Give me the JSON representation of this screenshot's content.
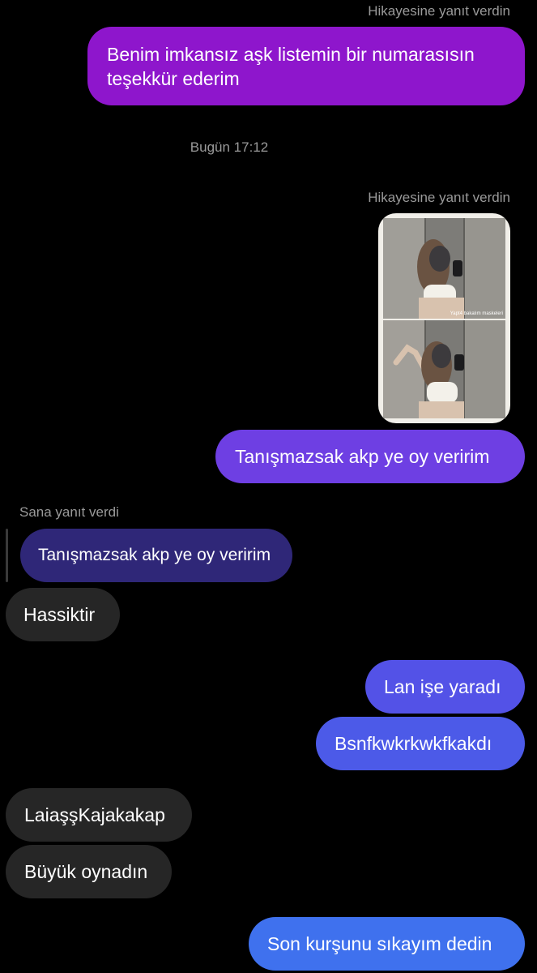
{
  "conversation": {
    "story_reply_label_1": "Hikayesine yanıt verdin",
    "msg_1": "Benim imkansız aşk listemin bir numarasısın teşekkür ederim",
    "timestamp": "Bugün 17:12",
    "story_reply_label_2": "Hikayesine yanıt verdin",
    "story_caption": "Yapt4 bakalım maskeleri",
    "msg_2": "Tanışmazsak akp ye oy veririm",
    "reply_label": "Sana yanıt verdi",
    "quoted_msg": "Tanışmazsak akp ye oy veririm",
    "msg_3": "Hassiktir",
    "msg_4": "Lan işe yaradı",
    "msg_5": "Bsnfkwkrkwkfkakdı",
    "msg_6": "LaiaşşKajakakap",
    "msg_7": "Büyük oynadın",
    "msg_8": "Son kurşunu sıkayım dedin"
  },
  "colors": {
    "background": "#000000",
    "outgoing_purple": "#8e16cc",
    "outgoing_violet": "#6e3fe3",
    "outgoing_blue": "#3f71ee",
    "incoming_gray": "#262626",
    "quoted_reply": "#2f2778",
    "meta_text": "#9a9a9a"
  }
}
